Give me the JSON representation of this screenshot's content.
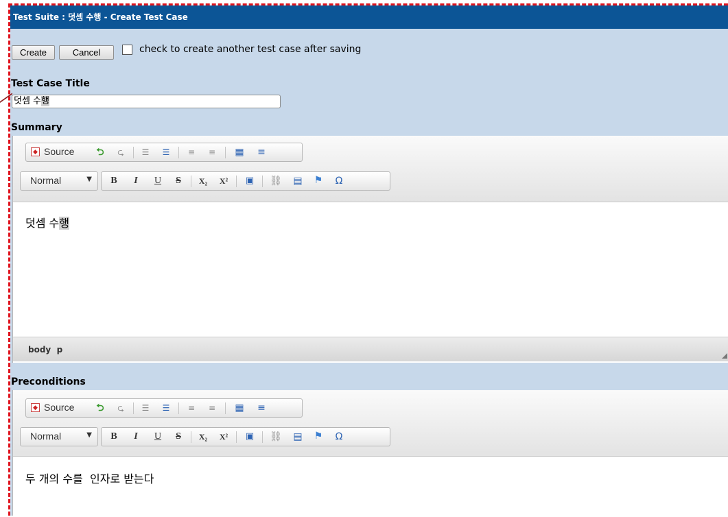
{
  "window": {
    "title": "Test Suite : 덧셈 수행 - Create Test Case"
  },
  "actions": {
    "create_label": "Create",
    "cancel_label": "Cancel",
    "create_another_label": "check to create another test case after saving",
    "create_another_checked": false
  },
  "fields": {
    "title_label": "Test Case Title",
    "title_value_prefix": "덧셈 수",
    "title_value_selected": "행",
    "summary_label": "Summary",
    "preconditions_label": "Preconditions"
  },
  "toolbar": {
    "source_label": "Source",
    "format_value": "Normal",
    "bold": "B",
    "italic": "I",
    "underline": "U",
    "strike": "S",
    "subscript": "X₂",
    "superscript": "X²",
    "special_char": "Ω",
    "icons": [
      "source-icon",
      "undo-icon",
      "redo-icon",
      "numbered-list-icon",
      "bulleted-list-icon",
      "outdent-icon",
      "indent-icon",
      "table-icon",
      "horizontal-rule-icon",
      "bold-icon",
      "italic-icon",
      "underline-icon",
      "strikethrough-icon",
      "subscript-icon",
      "superscript-icon",
      "html-embed-icon",
      "link-icon",
      "image-icon",
      "flag-anchor-icon",
      "special-char-icon"
    ]
  },
  "summary_editor": {
    "content_prefix": "덧셈 수",
    "content_selected": "행",
    "path_body": "body",
    "path_p": "p"
  },
  "preconditions_editor": {
    "content": "두 개의 수를  인자로 받는다"
  }
}
